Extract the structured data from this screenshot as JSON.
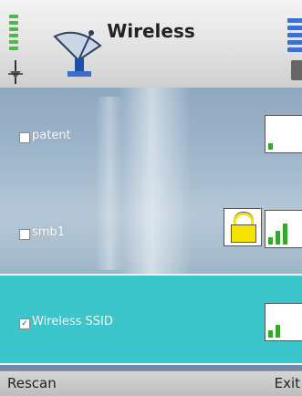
{
  "header": {
    "title": "Wireless"
  },
  "networks": [
    {
      "name": "patent",
      "checked": false,
      "locked": false,
      "signal_bars": 1
    },
    {
      "name": "smb1",
      "checked": false,
      "locked": true,
      "signal_bars": 3
    },
    {
      "name": "Wireless SSID",
      "checked": true,
      "locked": false,
      "signal_bars": 2
    }
  ],
  "softkeys": {
    "left": "Rescan",
    "right": "Exit"
  },
  "colors": {
    "selected_row": "#3cc6cb",
    "signal_green": "#34a82c",
    "lock_yellow": "#f5e400",
    "status_bar_blue": "#3c6fd1"
  },
  "icons": [
    "signal-strength-icon",
    "antenna-icon",
    "satellite-dish-icon",
    "battery-icon",
    "lock-icon",
    "wifi-signal-icon"
  ]
}
